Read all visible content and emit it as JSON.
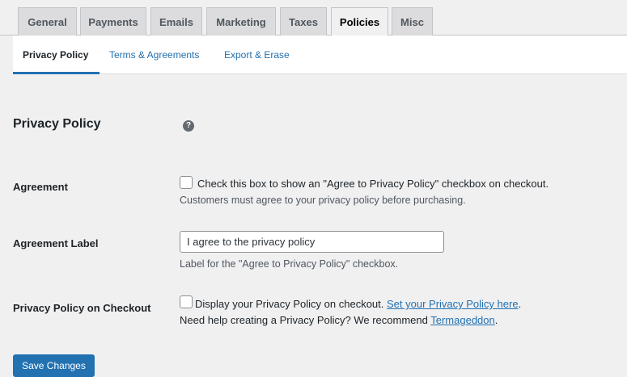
{
  "top_tabs": [
    {
      "label": "General"
    },
    {
      "label": "Payments"
    },
    {
      "label": "Emails"
    },
    {
      "label": "Marketing"
    },
    {
      "label": "Taxes"
    },
    {
      "label": "Policies",
      "active": true
    },
    {
      "label": "Misc"
    }
  ],
  "sub_tabs": [
    {
      "label": "Privacy Policy",
      "active": true
    },
    {
      "label": "Terms & Agreements"
    },
    {
      "label": "Export & Erase"
    }
  ],
  "section": {
    "title": "Privacy Policy",
    "help_glyph": "?"
  },
  "agreement": {
    "label": "Agreement",
    "checkbox_text": "Check this box to show an \"Agree to Privacy Policy\" checkbox on checkout.",
    "description": "Customers must agree to your privacy policy before purchasing."
  },
  "agreement_label": {
    "label": "Agreement Label",
    "value": "I agree to the privacy policy",
    "description": "Label for the \"Agree to Privacy Policy\" checkbox."
  },
  "privacy_checkout": {
    "label": "Privacy Policy on Checkout",
    "checkbox_text": "Display your Privacy Policy on checkout.",
    "link_text": "Set your Privacy Policy here",
    "link_suffix": ".",
    "help_text": "Need help creating a Privacy Policy? We recommend",
    "help_link": "Termageddon",
    "help_suffix": "."
  },
  "save_label": "Save Changes"
}
